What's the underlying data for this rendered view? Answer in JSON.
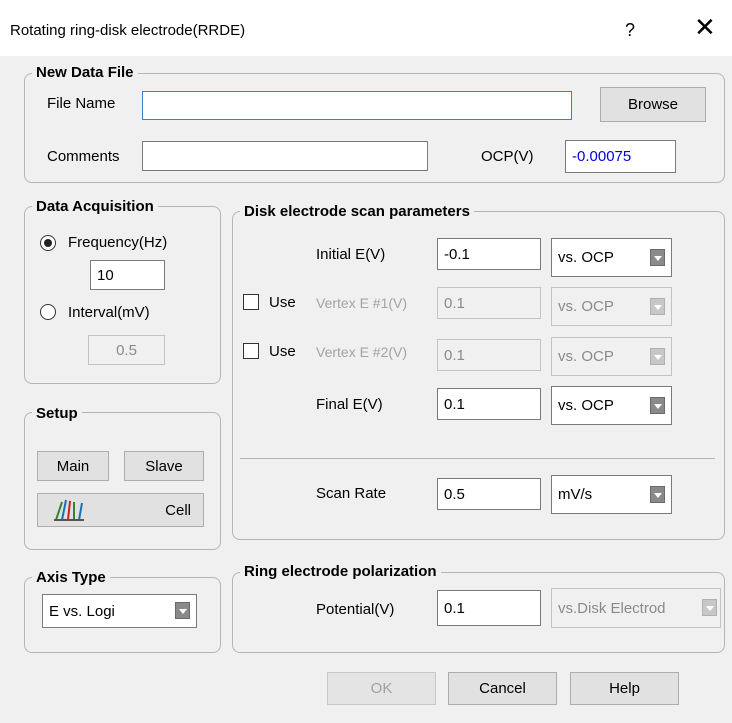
{
  "window": {
    "title": "Rotating ring-disk electrode(RRDE)",
    "help": "?",
    "close": "✕"
  },
  "new_data_file": {
    "title": "New Data File",
    "file_name_label": "File Name",
    "file_name_value": "",
    "browse": "Browse",
    "comments_label": "Comments",
    "comments_value": "",
    "ocp_label": "OCP(V)",
    "ocp_value": "-0.00075"
  },
  "data_acquisition": {
    "title": "Data Acquisition",
    "frequency_label": "Frequency(Hz)",
    "frequency_value": "10",
    "interval_label": "Interval(mV)",
    "interval_value": "0.5"
  },
  "setup": {
    "title": "Setup",
    "main": "Main",
    "slave": "Slave",
    "cell": "Cell"
  },
  "axis_type": {
    "title": "Axis Type",
    "value": "E vs. Logi"
  },
  "disk": {
    "title": "Disk electrode scan parameters",
    "initial_label": "Initial E(V)",
    "initial_value": "-0.1",
    "initial_ref": "vs. OCP",
    "use_label": "Use",
    "vertex1_label": "Vertex E #1(V)",
    "vertex1_value": "0.1",
    "vertex1_ref": "vs. OCP",
    "vertex2_label": "Vertex E #2(V)",
    "vertex2_value": "0.1",
    "vertex2_ref": "vs. OCP",
    "final_label": "Final E(V)",
    "final_value": "0.1",
    "final_ref": "vs. OCP",
    "scan_rate_label": "Scan Rate",
    "scan_rate_value": "0.5",
    "scan_rate_unit": "mV/s"
  },
  "ring": {
    "title": "Ring electrode polarization",
    "potential_label": "Potential(V)",
    "potential_value": "0.1",
    "potential_ref": "vs.Disk Electrod"
  },
  "buttons": {
    "ok": "OK",
    "cancel": "Cancel",
    "help": "Help"
  }
}
